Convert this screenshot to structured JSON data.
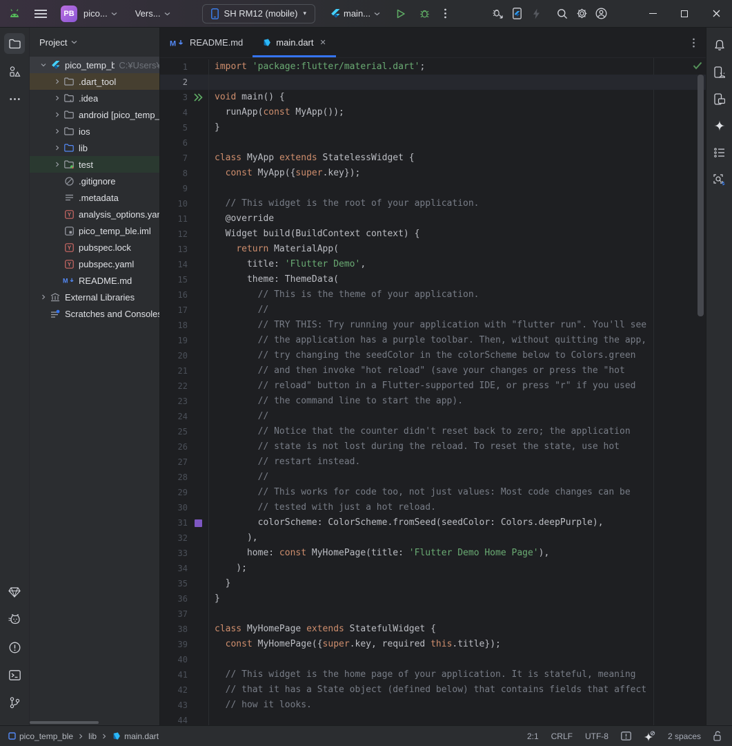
{
  "titlebar": {
    "project_badge": "PB",
    "project_selector": "pico...",
    "vcs_widget": "Vers...",
    "device_selector": "SH RM12 (mobile)",
    "run_config": "main..."
  },
  "project_panel": {
    "header": "Project",
    "tree": [
      {
        "label": "pico_temp_ble",
        "extra": "C:¥Users¥n",
        "icon": "flutter",
        "chevron": "down",
        "indent": 1,
        "row": "selected"
      },
      {
        "label": ".dart_tool",
        "icon": "folder",
        "chevron": "right",
        "indent": 2,
        "row": "excluded"
      },
      {
        "label": ".idea",
        "icon": "folder-idea",
        "chevron": "right",
        "indent": 2
      },
      {
        "label": "android [pico_temp_ble]",
        "icon": "folder",
        "chevron": "right",
        "indent": 2
      },
      {
        "label": "ios",
        "icon": "folder",
        "chevron": "right",
        "indent": 2
      },
      {
        "label": "lib",
        "icon": "folder-blue",
        "chevron": "right",
        "indent": 2
      },
      {
        "label": "test",
        "icon": "folder-test",
        "chevron": "right",
        "indent": 2,
        "row": "test"
      },
      {
        "label": ".gitignore",
        "icon": "ignored",
        "indent": 2
      },
      {
        "label": ".metadata",
        "icon": "textfile",
        "indent": 2
      },
      {
        "label": "analysis_options.yaml",
        "icon": "yaml",
        "indent": 2
      },
      {
        "label": "pico_temp_ble.iml",
        "icon": "iml",
        "indent": 2
      },
      {
        "label": "pubspec.lock",
        "icon": "yaml",
        "indent": 2
      },
      {
        "label": "pubspec.yaml",
        "icon": "yaml",
        "indent": 2
      },
      {
        "label": "README.md",
        "icon": "markdown",
        "indent": 2
      },
      {
        "label": "External Libraries",
        "icon": "libraries",
        "chevron": "right",
        "indent": 1
      },
      {
        "label": "Scratches and Consoles",
        "icon": "scratches",
        "indent": 1
      }
    ]
  },
  "tabs": [
    {
      "label": "README.md",
      "icon": "markdown",
      "active": false
    },
    {
      "label": "main.dart",
      "icon": "dart",
      "active": true,
      "closable": true
    }
  ],
  "editor": {
    "current_line": 2,
    "lines": [
      {
        "n": 1,
        "t": [
          [
            "k",
            "import"
          ],
          [
            "d",
            " "
          ],
          [
            "s",
            "'package:flutter/material.dart'"
          ],
          [
            "d",
            ";"
          ]
        ]
      },
      {
        "n": 2,
        "t": []
      },
      {
        "n": 3,
        "g": "run",
        "t": [
          [
            "k",
            "void"
          ],
          [
            "d",
            " main() {"
          ]
        ]
      },
      {
        "n": 4,
        "t": [
          [
            "d",
            "  runApp("
          ],
          [
            "k",
            "const"
          ],
          [
            "d",
            " MyApp());"
          ]
        ]
      },
      {
        "n": 5,
        "t": [
          [
            "d",
            "}"
          ]
        ]
      },
      {
        "n": 6,
        "t": []
      },
      {
        "n": 7,
        "t": [
          [
            "k",
            "class"
          ],
          [
            "d",
            " MyApp "
          ],
          [
            "k",
            "extends"
          ],
          [
            "d",
            " StatelessWidget {"
          ]
        ]
      },
      {
        "n": 8,
        "t": [
          [
            "d",
            "  "
          ],
          [
            "k",
            "const"
          ],
          [
            "d",
            " MyApp({"
          ],
          [
            "k",
            "super"
          ],
          [
            "d",
            ".key});"
          ]
        ]
      },
      {
        "n": 9,
        "t": []
      },
      {
        "n": 10,
        "t": [
          [
            "c",
            "  // This widget is the root of your application."
          ]
        ]
      },
      {
        "n": 11,
        "t": [
          [
            "d",
            "  @override"
          ]
        ]
      },
      {
        "n": 12,
        "t": [
          [
            "d",
            "  Widget build(BuildContext context) {"
          ]
        ]
      },
      {
        "n": 13,
        "t": [
          [
            "d",
            "    "
          ],
          [
            "k",
            "return"
          ],
          [
            "d",
            " MaterialApp("
          ]
        ]
      },
      {
        "n": 14,
        "t": [
          [
            "d",
            "      title: "
          ],
          [
            "s",
            "'Flutter Demo'"
          ],
          [
            "d",
            ","
          ]
        ]
      },
      {
        "n": 15,
        "t": [
          [
            "d",
            "      theme: ThemeData("
          ]
        ]
      },
      {
        "n": 16,
        "t": [
          [
            "c",
            "        // This is the theme of your application."
          ]
        ]
      },
      {
        "n": 17,
        "t": [
          [
            "c",
            "        //"
          ]
        ]
      },
      {
        "n": 18,
        "t": [
          [
            "c",
            "        // TRY THIS: Try running your application with \"flutter run\". You'll see"
          ]
        ]
      },
      {
        "n": 19,
        "t": [
          [
            "c",
            "        // the application has a purple toolbar. Then, without quitting the app,"
          ]
        ]
      },
      {
        "n": 20,
        "t": [
          [
            "c",
            "        // try changing the seedColor in the colorScheme below to Colors.green"
          ]
        ]
      },
      {
        "n": 21,
        "t": [
          [
            "c",
            "        // and then invoke \"hot reload\" (save your changes or press the \"hot"
          ]
        ]
      },
      {
        "n": 22,
        "t": [
          [
            "c",
            "        // reload\" button in a Flutter-supported IDE, or press \"r\" if you used"
          ]
        ]
      },
      {
        "n": 23,
        "t": [
          [
            "c",
            "        // the command line to start the app)."
          ]
        ]
      },
      {
        "n": 24,
        "t": [
          [
            "c",
            "        //"
          ]
        ]
      },
      {
        "n": 25,
        "t": [
          [
            "c",
            "        // Notice that the counter didn't reset back to zero; the application"
          ]
        ]
      },
      {
        "n": 26,
        "t": [
          [
            "c",
            "        // state is not lost during the reload. To reset the state, use hot"
          ]
        ]
      },
      {
        "n": 27,
        "t": [
          [
            "c",
            "        // restart instead."
          ]
        ]
      },
      {
        "n": 28,
        "t": [
          [
            "c",
            "        //"
          ]
        ]
      },
      {
        "n": 29,
        "t": [
          [
            "c",
            "        // This works for code too, not just values: Most code changes can be"
          ]
        ]
      },
      {
        "n": 30,
        "t": [
          [
            "c",
            "        // tested with just a hot reload."
          ]
        ]
      },
      {
        "n": 31,
        "g": "swatch",
        "t": [
          [
            "d",
            "        colorScheme: ColorScheme.fromSeed(seedColor: Colors.deepPurple),"
          ]
        ]
      },
      {
        "n": 32,
        "t": [
          [
            "d",
            "      ),"
          ]
        ]
      },
      {
        "n": 33,
        "t": [
          [
            "d",
            "      home: "
          ],
          [
            "k",
            "const"
          ],
          [
            "d",
            " MyHomePage(title: "
          ],
          [
            "s",
            "'Flutter Demo Home Page'"
          ],
          [
            "d",
            "),"
          ]
        ]
      },
      {
        "n": 34,
        "t": [
          [
            "d",
            "    );"
          ]
        ]
      },
      {
        "n": 35,
        "t": [
          [
            "d",
            "  }"
          ]
        ]
      },
      {
        "n": 36,
        "t": [
          [
            "d",
            "}"
          ]
        ]
      },
      {
        "n": 37,
        "t": []
      },
      {
        "n": 38,
        "t": [
          [
            "k",
            "class"
          ],
          [
            "d",
            " MyHomePage "
          ],
          [
            "k",
            "extends"
          ],
          [
            "d",
            " StatefulWidget {"
          ]
        ]
      },
      {
        "n": 39,
        "t": [
          [
            "d",
            "  "
          ],
          [
            "k",
            "const"
          ],
          [
            "d",
            " MyHomePage({"
          ],
          [
            "k",
            "super"
          ],
          [
            "d",
            ".key, required "
          ],
          [
            "k",
            "this"
          ],
          [
            "d",
            ".title});"
          ]
        ]
      },
      {
        "n": 40,
        "t": []
      },
      {
        "n": 41,
        "t": [
          [
            "c",
            "  // This widget is the home page of your application. It is stateful, meaning"
          ]
        ]
      },
      {
        "n": 42,
        "t": [
          [
            "c",
            "  // that it has a State object (defined below) that contains fields that affect"
          ]
        ]
      },
      {
        "n": 43,
        "t": [
          [
            "c",
            "  // how it looks."
          ]
        ]
      },
      {
        "n": 44,
        "t": []
      }
    ]
  },
  "status_bar": {
    "breadcrumbs": [
      {
        "label": "pico_temp_ble",
        "icon": "module"
      },
      {
        "label": "lib"
      },
      {
        "label": "main.dart",
        "icon": "dart"
      }
    ],
    "caret_position": "2:1",
    "line_separator": "CRLF",
    "encoding": "UTF-8",
    "indent": "2 spaces"
  },
  "colors": {
    "accent_blue": "#3574f0",
    "keyword": "#cf8e6d",
    "string": "#6aab73",
    "comment": "#787d87",
    "run_green": "#5fad65",
    "color_swatch_deep_purple": "#7e57c2"
  }
}
